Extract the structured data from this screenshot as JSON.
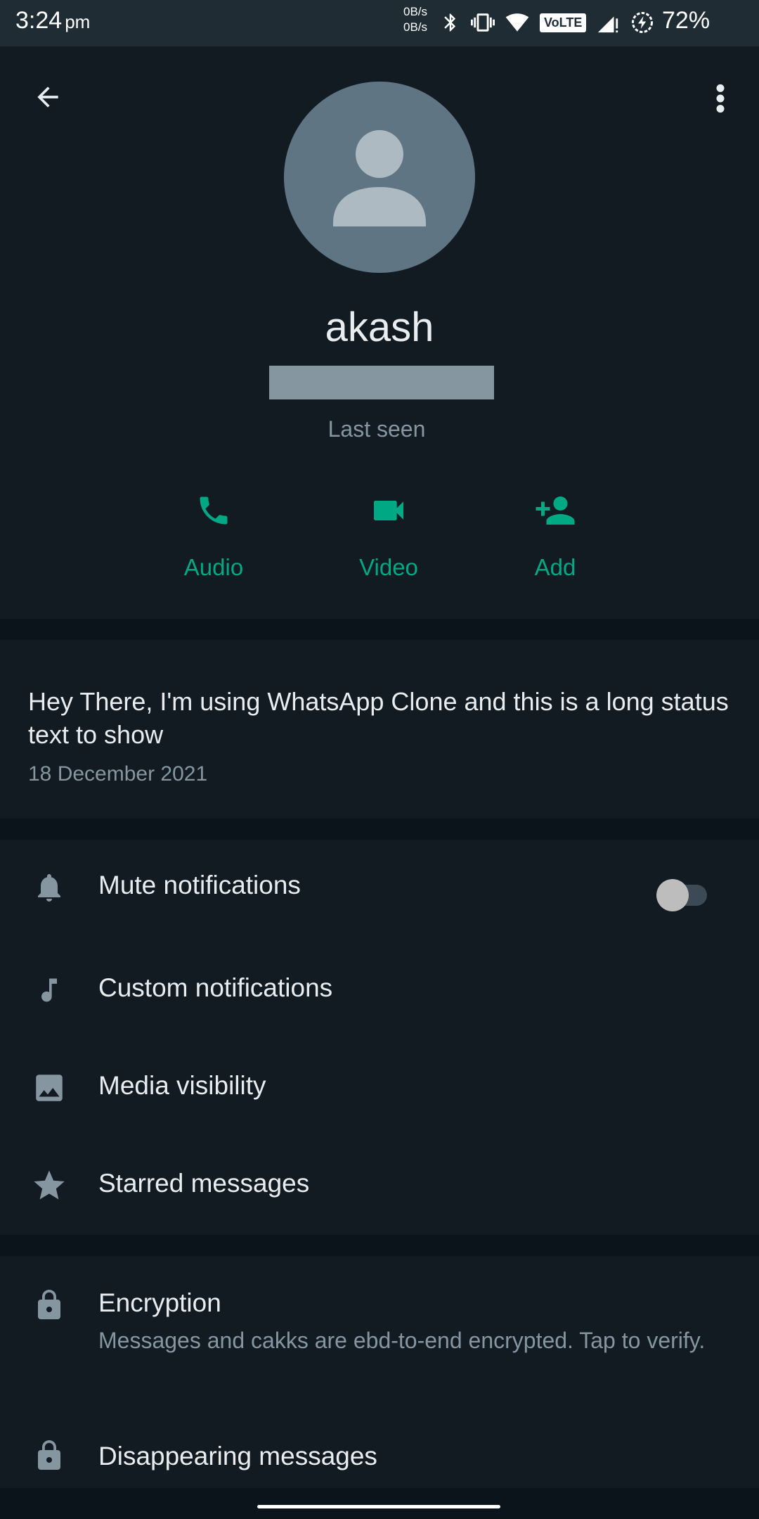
{
  "status_bar": {
    "time": "3:24",
    "ampm": "pm",
    "net_up": "0B/s",
    "net_down": "0B/s",
    "volte": "VoLTE",
    "battery": "72%"
  },
  "profile": {
    "name": "akash",
    "last_seen": "Last seen"
  },
  "actions": {
    "audio": "Audio",
    "video": "Video",
    "add": "Add"
  },
  "about": {
    "status": "Hey There, I'm using WhatsApp Clone and this is a long status text to show",
    "date": "18 December 2021"
  },
  "settings": {
    "mute": "Mute notifications",
    "custom": "Custom notifications",
    "media": "Media visibility",
    "starred": "Starred messages",
    "mute_enabled": false
  },
  "security": {
    "encryption_title": "Encryption",
    "encryption_desc": "Messages and cakks are ebd-to-end encrypted. Tap to verify.",
    "disappearing": "Disappearing messages"
  },
  "colors": {
    "accent": "#00A884",
    "background": "#121B22",
    "separator": "#0B141A",
    "secondary_text": "#8696A0"
  }
}
